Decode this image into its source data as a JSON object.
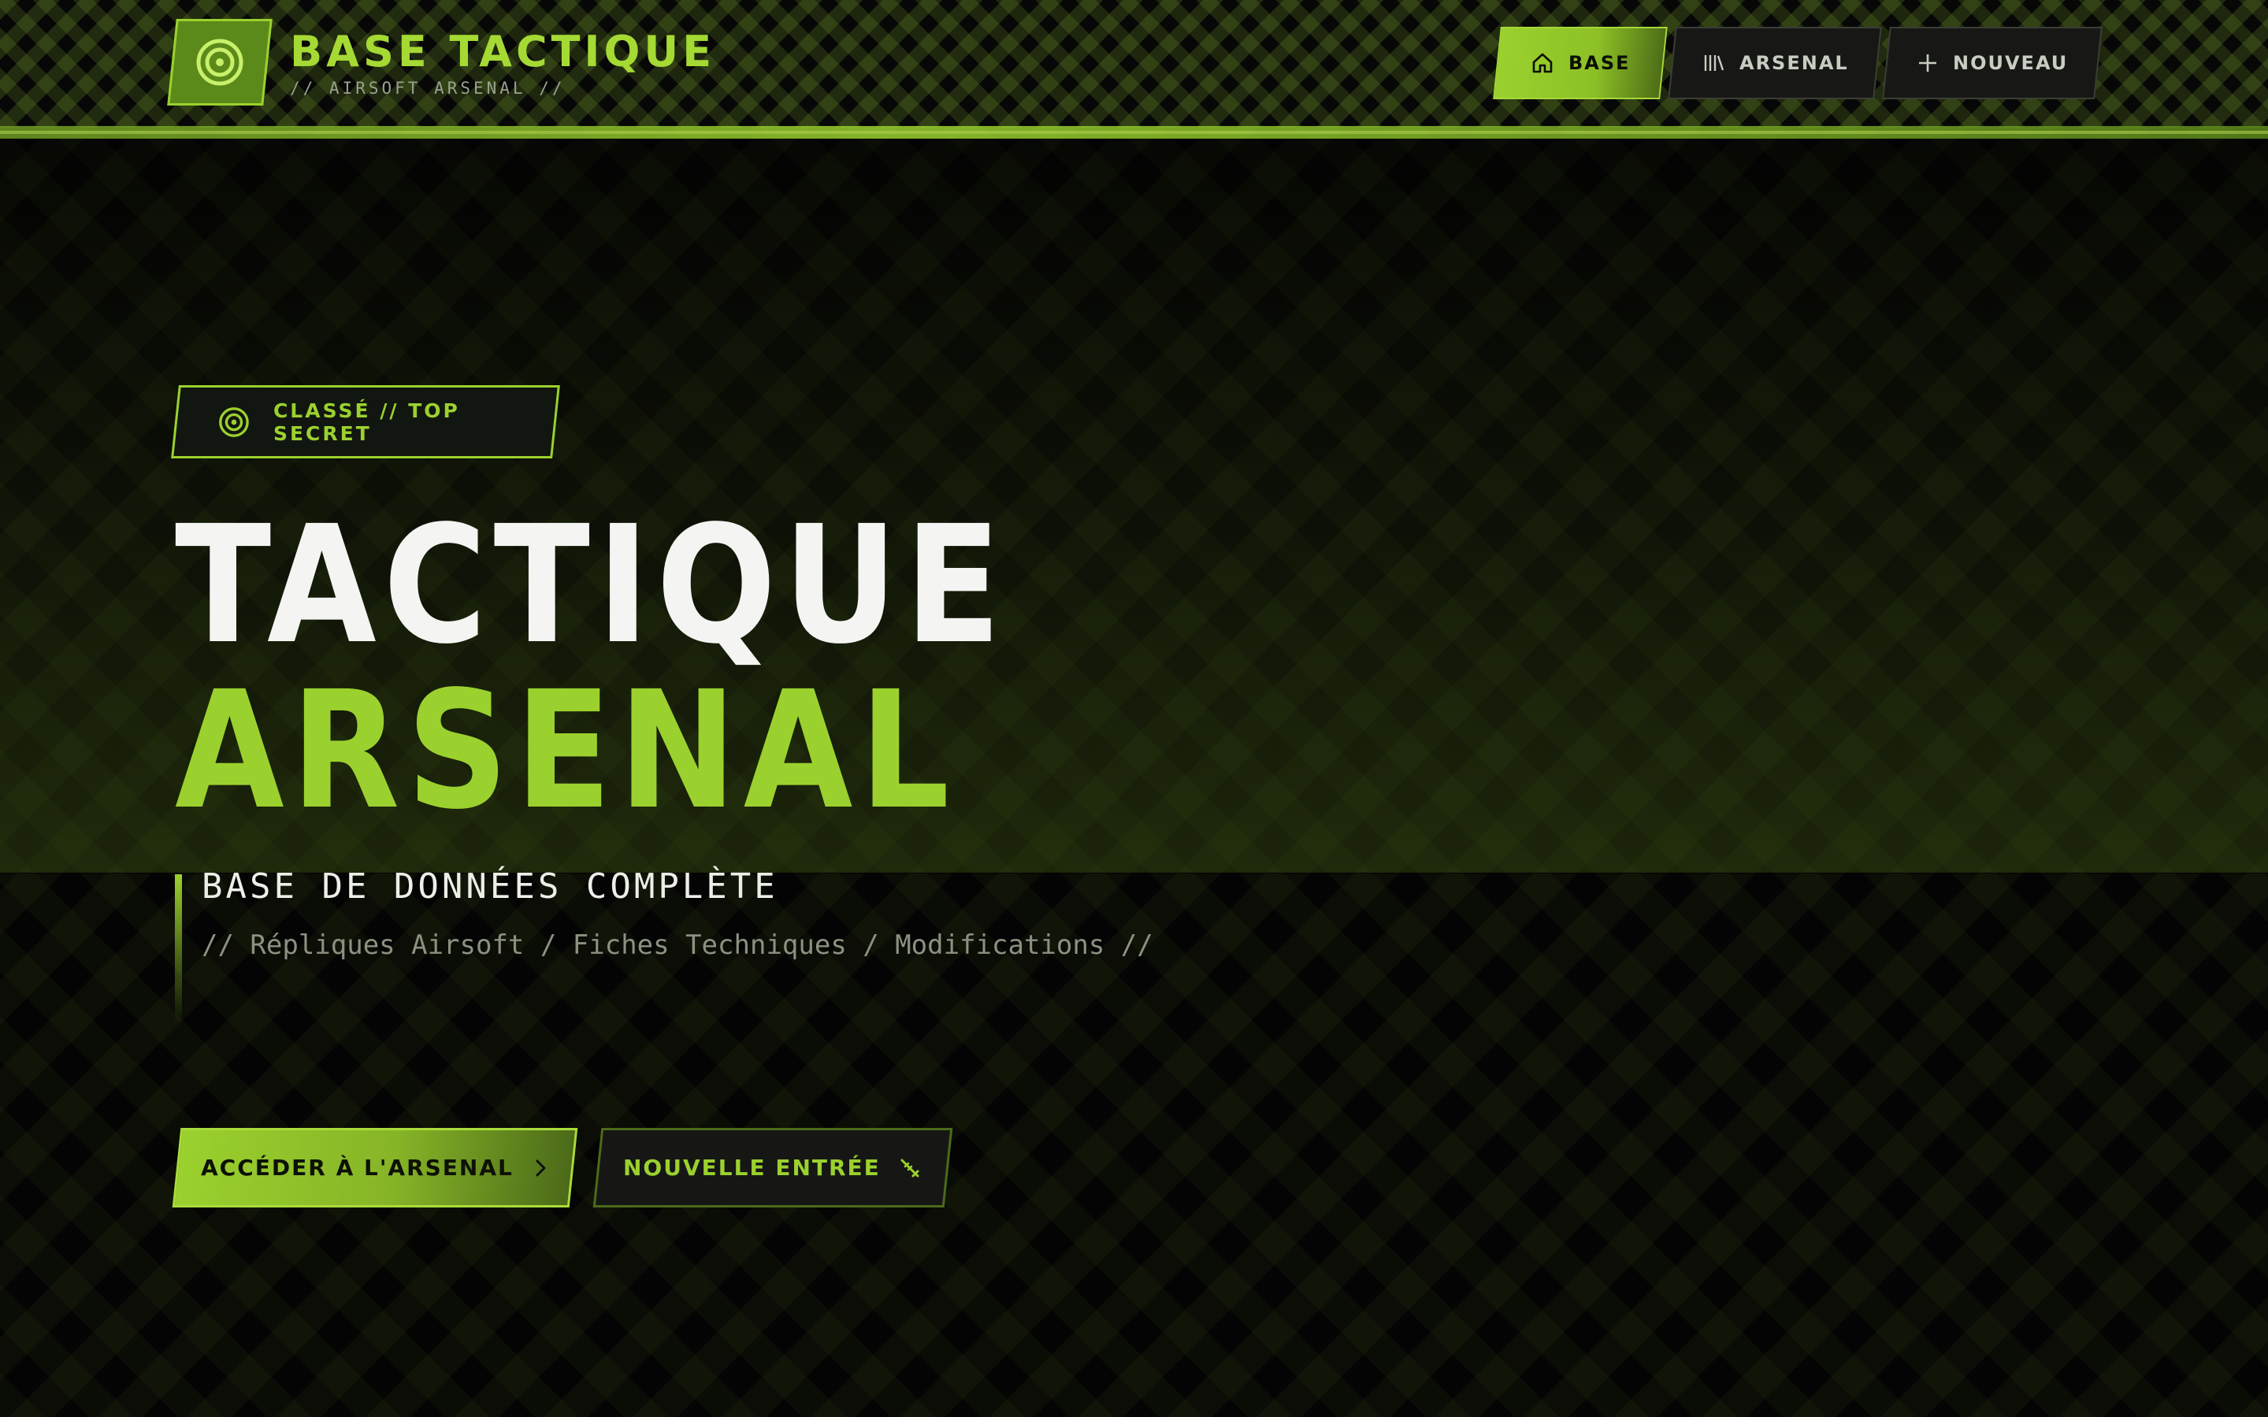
{
  "header": {
    "brand_title": "BASE TACTIQUE",
    "brand_subtitle": "// AIRSOFT ARSENAL //",
    "logo_icon": "target-icon",
    "nav": [
      {
        "label": "BASE",
        "icon": "home-icon",
        "active": true
      },
      {
        "label": "ARSENAL",
        "icon": "library-icon",
        "active": false
      },
      {
        "label": "NOUVEAU",
        "icon": "plus-icon",
        "active": false
      }
    ]
  },
  "hero": {
    "badge": "CLASSÉ // TOP SECRET",
    "title_line1": "TACTIQUE",
    "title_line2": "ARSENAL",
    "subtitle": "BASE DE DONNÉES COMPLÈTE",
    "tagline": "// Répliques Airsoft / Fiches Techniques / Modifications //",
    "primary_cta": "ACCÉDER À L'ARSENAL",
    "secondary_cta": "NOUVELLE ENTRÉE"
  },
  "colors": {
    "accent": "#9bd12e",
    "background": "#040404",
    "text_light": "#f4f5f2",
    "muted": "#8a9280"
  }
}
